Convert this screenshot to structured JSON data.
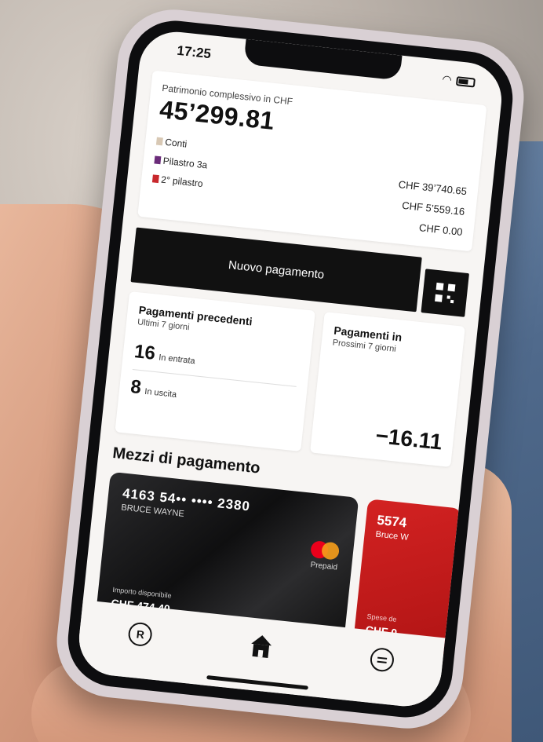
{
  "status_bar": {
    "time": "17:25",
    "wifi_icon": "wifi-icon",
    "battery_icon": "battery-icon"
  },
  "wealth": {
    "label": "Patrimonio complessivo in CHF",
    "amount": "45’299.81",
    "assets": [
      {
        "name": "Conti",
        "color": "#d8c8b4"
      },
      {
        "name": "Pilastro 3a",
        "color": "#6b2c7a"
      },
      {
        "name": "2° pilastro",
        "color": "#c8282d"
      }
    ],
    "values": [
      "CHF 39’740.65",
      "CHF 5’559.16",
      "CHF 0.00"
    ]
  },
  "actions": {
    "new_payment": "Nuovo pagamento",
    "qr_icon": "qr-code-icon"
  },
  "previous_payments": {
    "title": "Pagamenti precedenti",
    "subtitle": "Ultimi 7 giorni",
    "incoming_count": "16",
    "incoming_label": "In entrata",
    "outgoing_count": "8",
    "outgoing_label": "In uscita"
  },
  "upcoming_payments": {
    "title": "Pagamenti in",
    "subtitle": "Prossimi 7 giorni",
    "amount": "−16.11"
  },
  "payment_methods": {
    "title": "Mezzi di pagamento",
    "debit_card": {
      "number": "4163 54•• •••• 2380",
      "holder": "BRUCE WAYNE",
      "type": "Prepaid",
      "available_label": "Importo disponibile",
      "available_amount": "CHF 474.40",
      "brand_icon": "mastercard-icon"
    },
    "credit_card": {
      "number": "5574",
      "holder": "Bruce W",
      "spend_label": "Spese de",
      "spend_amount": "CHF 0"
    }
  },
  "bottom_nav": {
    "left_icon_glyph": "R",
    "items": [
      "raiffeisen-icon",
      "home-icon",
      "menu-icon"
    ]
  },
  "colors": {
    "accent_red": "#c8282d",
    "dark": "#111111",
    "background": "#f7f5f3"
  }
}
